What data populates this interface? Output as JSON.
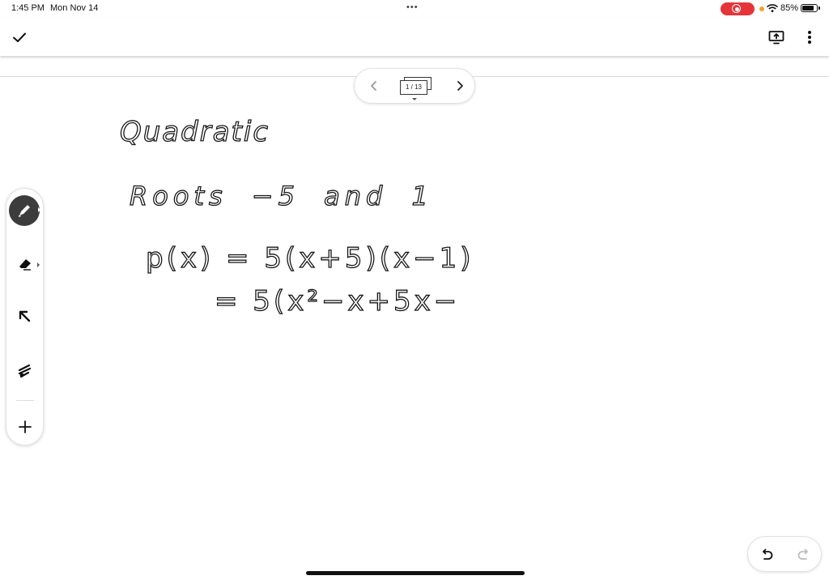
{
  "status_bar": {
    "time": "1:45 PM",
    "date": "Mon Nov 14",
    "multitask_dots": "•••",
    "battery_percent": "85%",
    "battery_level": 0.85,
    "recording_color": "#e5353a",
    "indicator_color": "#f2a12b"
  },
  "toolbar": {
    "done_icon": "checkmark-icon",
    "present_icon": "present-icon",
    "more_icon": "more-vertical-icon"
  },
  "pager": {
    "page_indicator": "1 / 13",
    "prev_icon": "chevron-left-icon",
    "next_icon": "chevron-right-icon"
  },
  "tools": {
    "items": [
      {
        "name": "pen",
        "icon": "pen-icon",
        "selected": true
      },
      {
        "name": "eraser",
        "icon": "eraser-icon",
        "selected": false
      },
      {
        "name": "select",
        "icon": "select-arrow-icon",
        "selected": false
      },
      {
        "name": "laser",
        "icon": "laser-pointer-icon",
        "selected": false
      },
      {
        "name": "add",
        "icon": "plus-icon",
        "selected": false
      }
    ],
    "selected_color": "#3c3c3c"
  },
  "handwriting": {
    "line1": "Quadratic",
    "line2": "Roots −5 and 1",
    "line3": "p(x) = 5(x+5)(x−1)",
    "line4": "= 5(x²−x+5x−"
  },
  "history": {
    "undo_icon": "undo-icon",
    "redo_icon": "redo-icon",
    "redo_enabled": false
  }
}
